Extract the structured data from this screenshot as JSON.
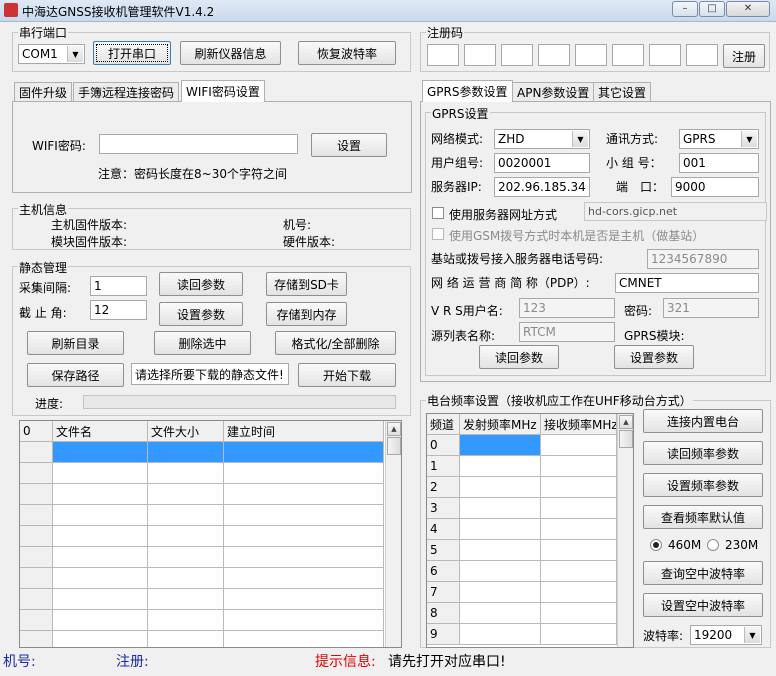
{
  "window": {
    "title": "中海达GNSS接收机管理软件V1.4.2"
  },
  "serial": {
    "legend": "串行端口",
    "port_value": "COM1",
    "open_btn": "打开串口",
    "refresh_btn": "刷新仪器信息",
    "restore_btn": "恢复波特率"
  },
  "register": {
    "legend": "注册码",
    "submit": "注册"
  },
  "left_tabs": [
    "固件升级",
    "手簿远程连接密码",
    "WIFI密码设置"
  ],
  "wifi": {
    "label": "WIFI密码:",
    "set_btn": "设置",
    "note": "注意：密码长度在8~30个字符之间"
  },
  "host": {
    "legend": "主机信息",
    "firmware": "主机固件版本:",
    "module_fw": "模块固件版本:",
    "model": "机号:",
    "hardware": "硬件版本:"
  },
  "static": {
    "legend": "静态管理",
    "interval_label": "采集间隔:",
    "interval_value": "1",
    "cutoff_label": "截 止 角:",
    "cutoff_value": "12",
    "read_params": "读回参数",
    "set_params": "设置参数",
    "save_sd": "存储到SD卡",
    "save_mem": "存储到内存",
    "refresh_dir": "刷新目录",
    "delete_sel": "删除选中",
    "format_all": "格式化/全部删除",
    "save_path": "保存路径",
    "select_hint": "请选择所要下载的静态文件!",
    "start_download": "开始下载",
    "progress_label": "进度:",
    "table_headers": [
      "0",
      "文件名",
      "文件大小",
      "建立时间"
    ]
  },
  "right_tabs": [
    "GPRS参数设置",
    "APN参数设置",
    "其它设置"
  ],
  "gprs": {
    "legend": "GPRS设置",
    "net_mode_label": "网络模式:",
    "net_mode_value": "ZHD",
    "comm_mode_label": "通讯方式:",
    "comm_mode_value": "GPRS",
    "user_group_label": "用户组号:",
    "user_group_value": "0020001",
    "small_group_label": "小 组 号：",
    "small_group_value": "001",
    "server_ip_label": "服务器IP:",
    "server_ip_value": "202.96.185.34",
    "port_label": "端　口：",
    "port_value": "9000",
    "use_domain_label": "使用服务器网址方式",
    "domain_value": "hd-cors.gicp.net",
    "gsm_label": "使用GSM拨号方式时本机是否是主机（做基站）",
    "dial_label": "基站或拨号接入服务器电话号码:",
    "dial_value": "1234567890",
    "pdp_label": "网 络 运 营 商 简 称（PDP）:",
    "pdp_value": "CMNET",
    "vrs_user_label": "V R S用户名:",
    "vrs_user_value": "123",
    "password_label": "密码:",
    "password_value": "321",
    "source_label": "源列表名称:",
    "source_value": "RTCM",
    "gprs_module_label": "GPRS模块:",
    "read_btn": "读回参数",
    "set_btn": "设置参数"
  },
  "radio": {
    "legend": "电台频率设置（接收机应工作在UHF移动台方式）",
    "headers": [
      "频道",
      "发射频率MHz",
      "接收频率MHz"
    ],
    "channels": [
      "0",
      "1",
      "2",
      "3",
      "4",
      "5",
      "6",
      "7",
      "8",
      "9"
    ],
    "connect_btn": "连接内置电台",
    "read_freq": "读回频率参数",
    "set_freq": "设置频率参数",
    "view_default": "查看频率默认值",
    "rate1": "460M",
    "rate2": "230M",
    "query_baud": "查询空中波特率",
    "set_baud": "设置空中波特率",
    "baud_label": "波特率:",
    "baud_value": "19200"
  },
  "status": {
    "machine": "机号:",
    "register": "注册:",
    "info_label": "提示信息:",
    "info_text": "请先打开对应串口!"
  },
  "colors": {
    "selection": "#3399ff",
    "status_blue": "#1a2aa8",
    "status_red": "#e00000"
  }
}
